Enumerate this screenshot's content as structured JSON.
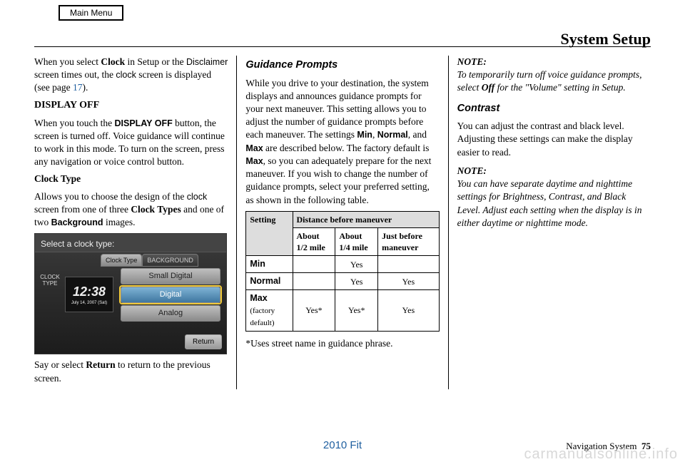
{
  "header": {
    "main_menu": "Main Menu",
    "page_title": "System Setup"
  },
  "col1": {
    "p1_a": "When you select ",
    "p1_b": "Clock",
    "p1_c": " in Setup or the ",
    "p1_d": "Disclaimer",
    "p1_e": " screen times out, the ",
    "p1_f": "clock",
    "p1_g": " screen is displayed (see page ",
    "p1_link": "17",
    "p1_h": ").",
    "h_display_off": "DISPLAY OFF",
    "p2_a": "When you touch the ",
    "p2_b": "DISPLAY OFF",
    "p2_c": " button, the screen is turned off. Voice guidance will continue to work in this mode. To turn on the screen, press any navigation or voice control button.",
    "h_clock_type": "Clock Type",
    "p3_a": "Allows you to choose the design of the ",
    "p3_b": "clock",
    "p3_c": " screen from one of three ",
    "p3_d": "Clock Types",
    "p3_e": " and one of two ",
    "p3_f": "Background",
    "p3_g": " images.",
    "p4_a": "Say or select ",
    "p4_b": "Return",
    "p4_c": " to return to the previous screen."
  },
  "clock_shot": {
    "title": "Select a clock type:",
    "side_label": "CLOCK TYPE",
    "tab1": "Clock Type",
    "tab2": "BACKGROUND",
    "time": "12:38",
    "date": "July 14, 2007 (Sat)",
    "opt1": "Small Digital",
    "opt2": "Digital",
    "opt3": "Analog",
    "return": "Return"
  },
  "col2": {
    "h_guidance": "Guidance Prompts",
    "p1": "While you drive to your destination, the system displays and announces guidance prompts for your next maneuver. This setting allows you to adjust the number of guidance prompts before each maneuver. The settings ",
    "p1_b": "Min",
    "p1_c": ", ",
    "p1_d": "Normal",
    "p1_e": ", and ",
    "p1_f": "Max",
    "p1_g": " are described below. The factory default is ",
    "p1_h": "Max",
    "p1_i": ", so you can adequately prepare for the next maneuver. If you wish to change the number of guidance prompts, select your preferred setting, as shown in the following table.",
    "footnote": "*Uses street name in guidance phrase."
  },
  "table": {
    "h_setting": "Setting",
    "h_distance": "Distance before maneuver",
    "sub1": "About 1/2 mile",
    "sub2": "About 1/4 mile",
    "sub3": "Just before maneuver",
    "r1_label": "Min",
    "r1_c1": "",
    "r1_c2": "Yes",
    "r1_c3": "",
    "r2_label": "Normal",
    "r2_c1": "",
    "r2_c2": "Yes",
    "r2_c3": "Yes",
    "r3_label_a": "Max",
    "r3_label_b": "(factory default)",
    "r3_c1": "Yes*",
    "r3_c2": "Yes*",
    "r3_c3": "Yes"
  },
  "col3": {
    "note1_h": "NOTE:",
    "note1_a": "To temporarily turn off voice guidance prompts, select ",
    "note1_b": "Off",
    "note1_c": " for the \"Volume\" setting in Setup.",
    "h_contrast": "Contrast",
    "p_contrast": "You can adjust the contrast and black level. Adjusting these settings can make the display easier to read.",
    "note2_h": "NOTE:",
    "note2": "You can have separate daytime and nighttime settings for Brightness, Contrast, and Black Level. Adjust each setting when the display is in either daytime or nighttime mode."
  },
  "footer": {
    "center": "2010 Fit",
    "right_label": "Navigation System",
    "page": "75",
    "watermark": "carmanualsonline.info"
  },
  "chart_data": {
    "type": "table",
    "title": "Guidance Prompts — Distance before maneuver",
    "columns": [
      "Setting",
      "About 1/2 mile",
      "About 1/4 mile",
      "Just before maneuver"
    ],
    "rows": [
      {
        "setting": "Min",
        "about_1_2_mile": "",
        "about_1_4_mile": "Yes",
        "just_before": ""
      },
      {
        "setting": "Normal",
        "about_1_2_mile": "",
        "about_1_4_mile": "Yes",
        "just_before": "Yes"
      },
      {
        "setting": "Max (factory default)",
        "about_1_2_mile": "Yes*",
        "about_1_4_mile": "Yes*",
        "just_before": "Yes"
      }
    ],
    "footnote": "*Uses street name in guidance phrase."
  }
}
